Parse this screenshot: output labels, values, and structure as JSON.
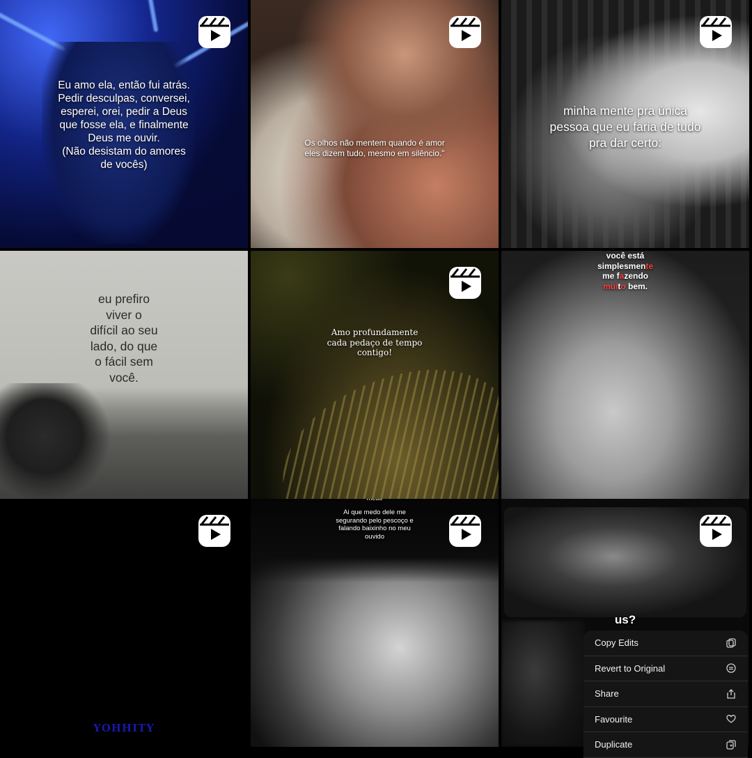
{
  "tiles": [
    {
      "caption": "Eu amo ela, então fui atrás.\nPedir desculpas, conversei,\nesperei, orei, pedir a Deus\nque fosse ela, e finalmente\nDeus me ouvir.\n(Não desistam do amores\nde vocês)",
      "is_reel": true
    },
    {
      "caption": "Os olhos não mentem quando é amor\neles dizem tudo, mesmo em silêncio.\"",
      "is_reel": true
    },
    {
      "caption": "minha mente pra única\npessoa que eu faria de tudo\npra dar certo:",
      "is_reel": true
    },
    {
      "caption": "eu prefiro\nviver o\ndifícil ao seu\nlado, do que\no fácil sem\nvocê.",
      "is_reel": false
    },
    {
      "caption": "Amo profundamente\ncada pedaço de tempo\ncontigo!",
      "is_reel": true
    },
    {
      "caption_parts": [
        "você está",
        "simplesmen",
        "te",
        "me f",
        "a",
        "zendo",
        "mui",
        "t",
        "o",
        "bem."
      ],
      "is_reel": false
    },
    {
      "watermark": "YOHHITY",
      "is_reel": true
    },
    {
      "caption_top": "medo",
      "caption": "Ai que medo dele me\nsegurando pelo pescoço e\nfalando baixinho no meu\nouvido",
      "is_reel": true
    },
    {
      "caption": "us?",
      "is_reel": true
    }
  ],
  "context_menu": {
    "items": [
      {
        "label": "Copy Edits",
        "icon": "copy-icon"
      },
      {
        "label": "Revert to Original",
        "icon": "revert-icon"
      },
      {
        "label": "Share",
        "icon": "share-icon"
      },
      {
        "label": "Favourite",
        "icon": "heart-icon"
      },
      {
        "label": "Duplicate",
        "icon": "duplicate-icon"
      }
    ]
  }
}
